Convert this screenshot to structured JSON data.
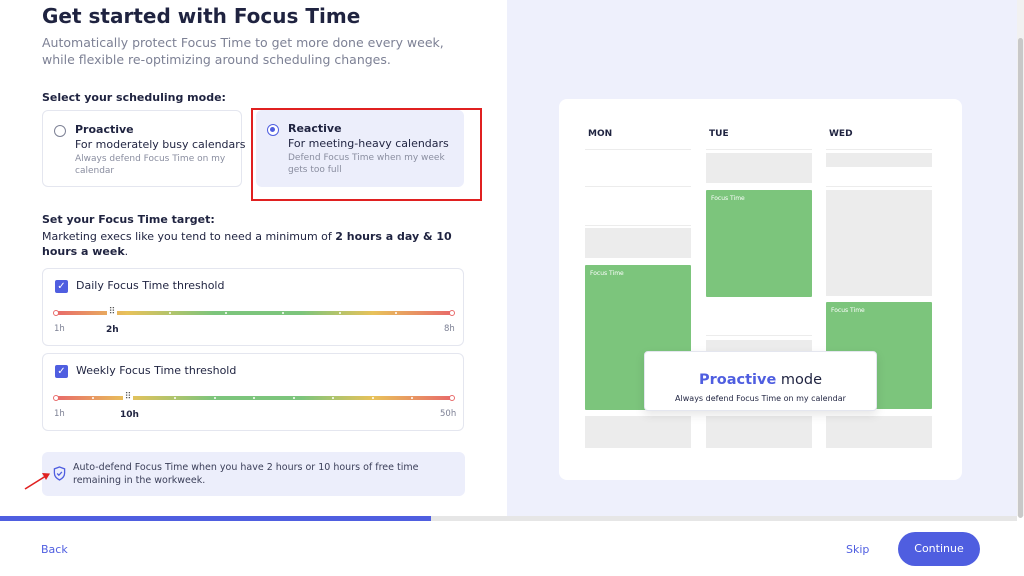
{
  "header": {
    "title": "Get started with Focus Time",
    "subtitle": "Automatically protect Focus Time to get more done every week, while flexible re-optimizing around scheduling changes."
  },
  "mode_section": {
    "label": "Select your scheduling mode:",
    "selected": "Reactive",
    "options": [
      {
        "name": "Proactive",
        "description": "For moderately busy calendars",
        "note": "Always defend Focus Time on my calendar"
      },
      {
        "name": "Reactive",
        "description": "For meeting-heavy calendars",
        "note": "Defend Focus Time when my week gets too full"
      }
    ]
  },
  "target_section": {
    "label": "Set your Focus Time target:",
    "text_prefix": "Marketing execs like you tend to need a minimum of ",
    "text_bold": "2 hours a day & 10 hours a week",
    "text_suffix": "."
  },
  "daily": {
    "label": "Daily Focus Time threshold",
    "checked": true,
    "min": "1h",
    "max": "8h",
    "value": "2h",
    "value_num": 2,
    "range": [
      1,
      8
    ],
    "fraction": 0.143
  },
  "weekly": {
    "label": "Weekly Focus Time threshold",
    "checked": true,
    "min": "1h",
    "max": "50h",
    "value": "10h",
    "value_num": 10,
    "range": [
      1,
      50
    ],
    "fraction": 0.184
  },
  "auto_defend": {
    "icon": "shield-check-icon",
    "text": "Auto-defend Focus Time when you have 2 hours or 10 hours of free time remaining in the workweek."
  },
  "preview": {
    "days": [
      "MON",
      "TUE",
      "WED"
    ],
    "block_label": "Focus Time",
    "overlay_accent": "Proactive",
    "overlay_rest": " mode",
    "overlay_sub": "Always defend Focus Time on my calendar"
  },
  "progress": {
    "fraction": 0.424
  },
  "footer": {
    "back": "Back",
    "skip": "Skip",
    "continue": "Continue"
  },
  "colors": {
    "accent": "#4f5ee0",
    "focus_green": "#7cc57c",
    "highlight_red": "#e02020",
    "panel_bg": "#eef0fc"
  }
}
